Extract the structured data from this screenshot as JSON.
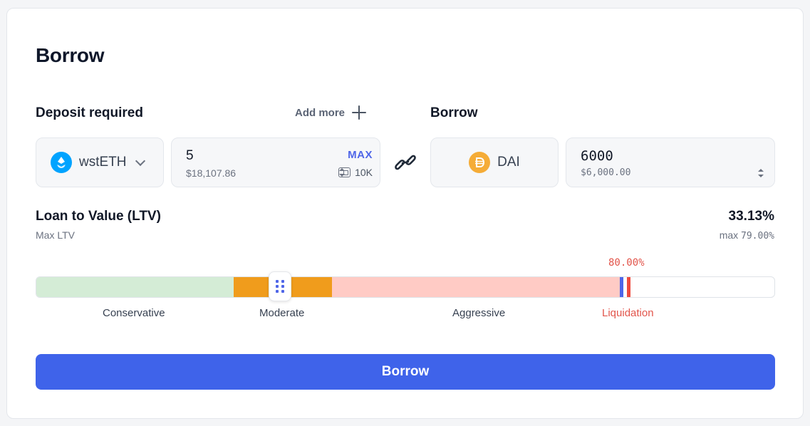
{
  "title": "Borrow",
  "deposit": {
    "label": "Deposit required",
    "add_more_label": "Add more",
    "token": "wstETH",
    "amount": "5",
    "amount_usd": "$18,107.86",
    "max_label": "MAX",
    "balance": "10K"
  },
  "borrow": {
    "label": "Borrow",
    "token": "DAI",
    "amount": "6000",
    "amount_usd": "$6,000.00"
  },
  "ltv": {
    "label": "Loan to Value (LTV)",
    "sub_label": "Max LTV",
    "value": "33.13%",
    "max_prefix": "max",
    "max_value": "79.00%",
    "liquidation_marker": "80.00%",
    "zones": {
      "conservative": "Conservative",
      "moderate": "Moderate",
      "aggressive": "Aggressive",
      "liquidation": "Liquidation"
    }
  },
  "colors": {
    "accent": "#3f63ea",
    "conservative": "#d4ecd6",
    "moderate": "#f09c1c",
    "aggressive": "#ffcbc5",
    "liquidation": "#ef4a3d",
    "wsteth_brand": "#00a3ff",
    "dai_brand": "#f5ac37"
  },
  "icons": {
    "wsteth": "wsteth-token-icon",
    "dai": "dai-token-icon",
    "link": "link-icon",
    "wallet": "wallet-icon",
    "plus": "plus-icon"
  },
  "button": {
    "label": "Borrow"
  }
}
